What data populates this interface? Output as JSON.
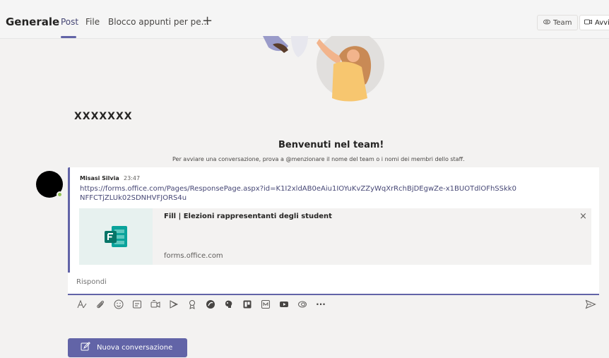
{
  "header": {
    "channel_title": "Generale",
    "tabs": [
      {
        "label": "Post"
      },
      {
        "label": "File"
      },
      {
        "label": "Blocco appunti per pe..."
      }
    ],
    "add_tab": "+",
    "team_label": "Team",
    "meet_label": "Avvia"
  },
  "welcome": {
    "team_name": "XXXXXXX",
    "title": "Benvenuti nel team!",
    "subtitle": "Per avviare una conversazione, prova a @menzionare il nome del team o i nomi dei membri dello staff."
  },
  "post": {
    "author": "Misasi Silvia",
    "time": "23:47",
    "link": "https://forms.office.com/Pages/ResponsePage.aspx?id=K1I2xldAB0eAiu1IOYuKvZZyWqXrRchBjDEgwZe-x1BUOTdlOFhSSkk0NFFCTjZLUk02SDNHVFJORS4u",
    "preview": {
      "title": "Fill | Elezioni rappresentanti degli student",
      "domain": "forms.office.com",
      "close": "×"
    }
  },
  "reply": {
    "placeholder": "Rispondi"
  },
  "toolbar": {
    "icons": [
      "format-icon",
      "attach-icon",
      "emoji-icon",
      "giphy-icon",
      "meet-now-icon",
      "stream-icon",
      "praise-icon",
      "stickers-icon",
      "app-icon",
      "trello-icon",
      "planner-icon",
      "youtube-icon",
      "loop-icon",
      "more-icon",
      "send-icon"
    ],
    "more": "···"
  },
  "new_conversation": {
    "label": "Nuova conversazione"
  },
  "colors": {
    "accent": "#6264a7",
    "link": "#464775",
    "presence": "#92c353",
    "forms_green": "#077568"
  }
}
